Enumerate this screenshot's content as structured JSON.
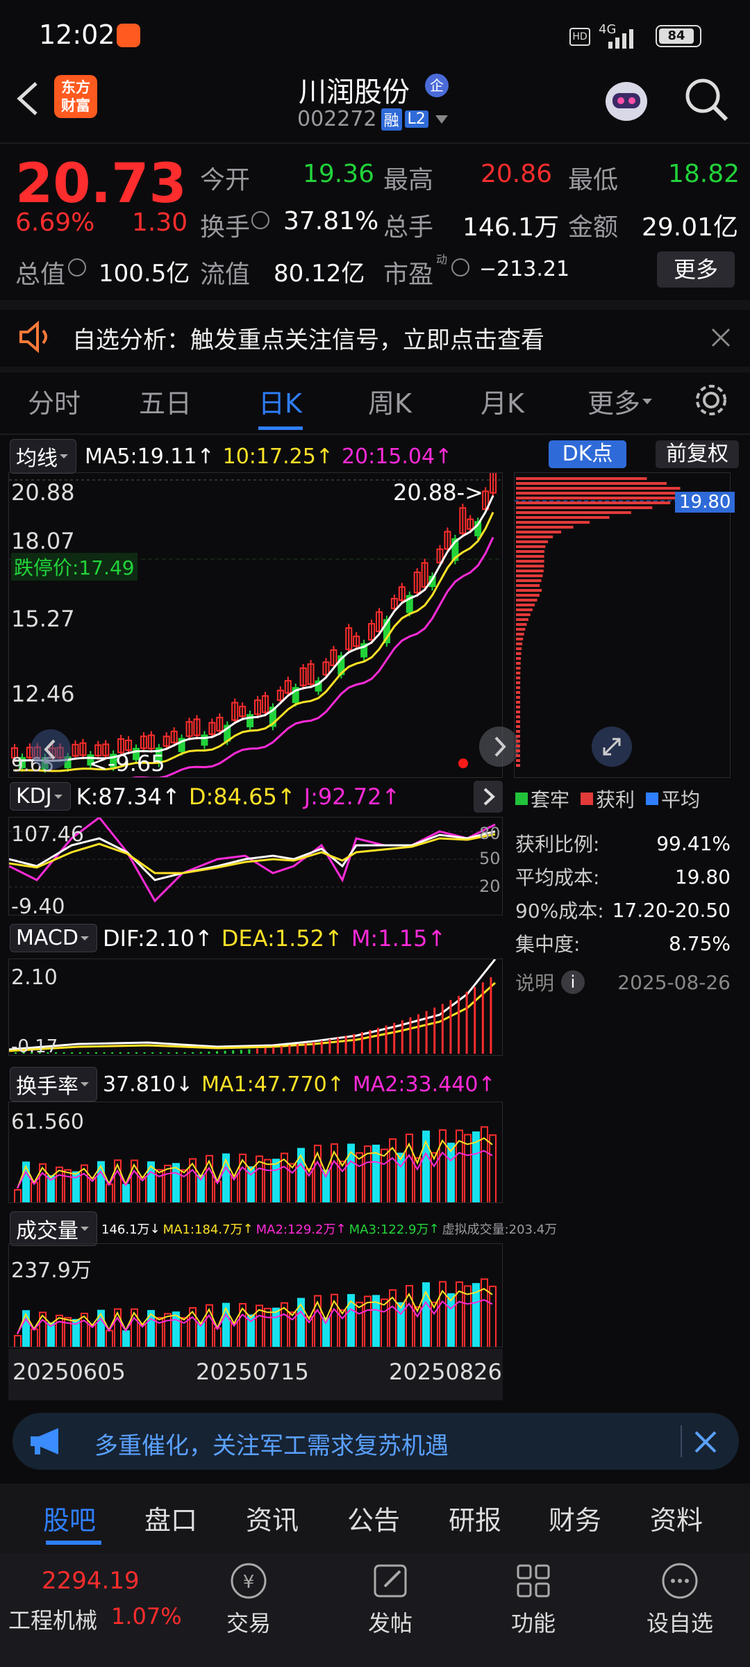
{
  "status_bar": {
    "time": "12:02",
    "network": "4G",
    "battery": "84"
  },
  "header": {
    "logo_line1": "东方",
    "logo_line2": "财富",
    "stock_name": "川润股份",
    "badge": "企",
    "code": "002272",
    "tag_margin": "融",
    "tag_l2": "L2"
  },
  "quote": {
    "price": "20.73",
    "change_pct": "6.69%",
    "change": "1.30",
    "open_label": "今开",
    "open": "19.36",
    "high_label": "最高",
    "high": "20.86",
    "low_label": "最低",
    "low": "18.82",
    "turnover_label": "换手",
    "turnover": "37.81%",
    "volume_label": "总手",
    "volume": "146.1万",
    "amount_label": "金额",
    "amount": "29.01亿",
    "mktcap_label": "总值",
    "mktcap": "100.5亿",
    "float_label": "流值",
    "float": "80.12亿",
    "pe_label": "市盈",
    "pe_sup": "动",
    "pe": "−213.21",
    "more_button": "更多"
  },
  "notice": {
    "text": "自选分析：触发重点关注信号，立即点击查看"
  },
  "tabs": [
    "分时",
    "五日",
    "日K",
    "周K",
    "月K",
    "更多"
  ],
  "active_tab": 2,
  "kline": {
    "indicator_select": "均线",
    "ma5": "MA5:19.11",
    "ma10": "10:17.25",
    "ma20": "20:15.04",
    "dk_button": "DK点",
    "adjust_button": "前复权",
    "y_labels": [
      "20.88",
      "18.07",
      "15.27",
      "12.46",
      "9.65"
    ],
    "limit_down": "跌停价:17.49",
    "high_marker": "20.88->",
    "low_marker": "<-9.65",
    "cost_price": "19.80"
  },
  "chip": {
    "legend": [
      "套牢",
      "获利",
      "平均"
    ],
    "profit_label": "获利比例:",
    "profit": "99.41%",
    "avg_label": "平均成本:",
    "avg": "19.80",
    "c90_label": "90%成本:",
    "c90": "17.20-20.50",
    "conc_label": "集中度:",
    "conc": "8.75%",
    "note_label": "说明",
    "date": "2025-08-26"
  },
  "kdj": {
    "select": "KDJ",
    "k": "K:87.34",
    "d": "D:84.65",
    "j": "J:92.72",
    "y_top": "107.46",
    "y_bottom": "-9.40",
    "levels": [
      "80",
      "50",
      "20"
    ]
  },
  "macd": {
    "select": "MACD",
    "dif": "DIF:2.10",
    "dea": "DEA:1.52",
    "m": "M:1.15",
    "y_top": "2.10",
    "y_bottom": "-0.17"
  },
  "turnover_panel": {
    "select": "换手率",
    "val": "37.810",
    "ma1": "MA1:47.770",
    "ma2": "MA2:33.440",
    "y_top": "61.560"
  },
  "volume_panel": {
    "select": "成交量",
    "val": "146.1万",
    "ma1": "MA1:184.7万",
    "ma2": "MA2:129.2万",
    "ma3": "MA3:122.9万",
    "virtual": "虚拟成交量:203.4万",
    "y_top": "237.9万"
  },
  "dates": [
    "20250605",
    "20250715",
    "20250826"
  ],
  "banner": {
    "text": "多重催化，关注军工需求复苏机遇"
  },
  "bottom_tabs": [
    "股吧",
    "盘口",
    "资讯",
    "公告",
    "研报",
    "财务",
    "资料"
  ],
  "footer": {
    "index_value": "2294.19",
    "index_name": "工程机械",
    "index_pct": "1.07%",
    "trade": "交易",
    "post": "发帖",
    "function": "功能",
    "watch": "设自选"
  },
  "colors": {
    "up": "#ff2d2d",
    "down": "#22d33a",
    "accent": "#2f7fff",
    "bg": "#0b0b0d"
  },
  "chart_data": {
    "type": "candlestick",
    "ma": {
      "MA5": 19.11,
      "MA10": 17.25,
      "MA20": 15.04
    },
    "price_range": [
      9.65,
      20.88
    ],
    "close_last": 20.73
  }
}
